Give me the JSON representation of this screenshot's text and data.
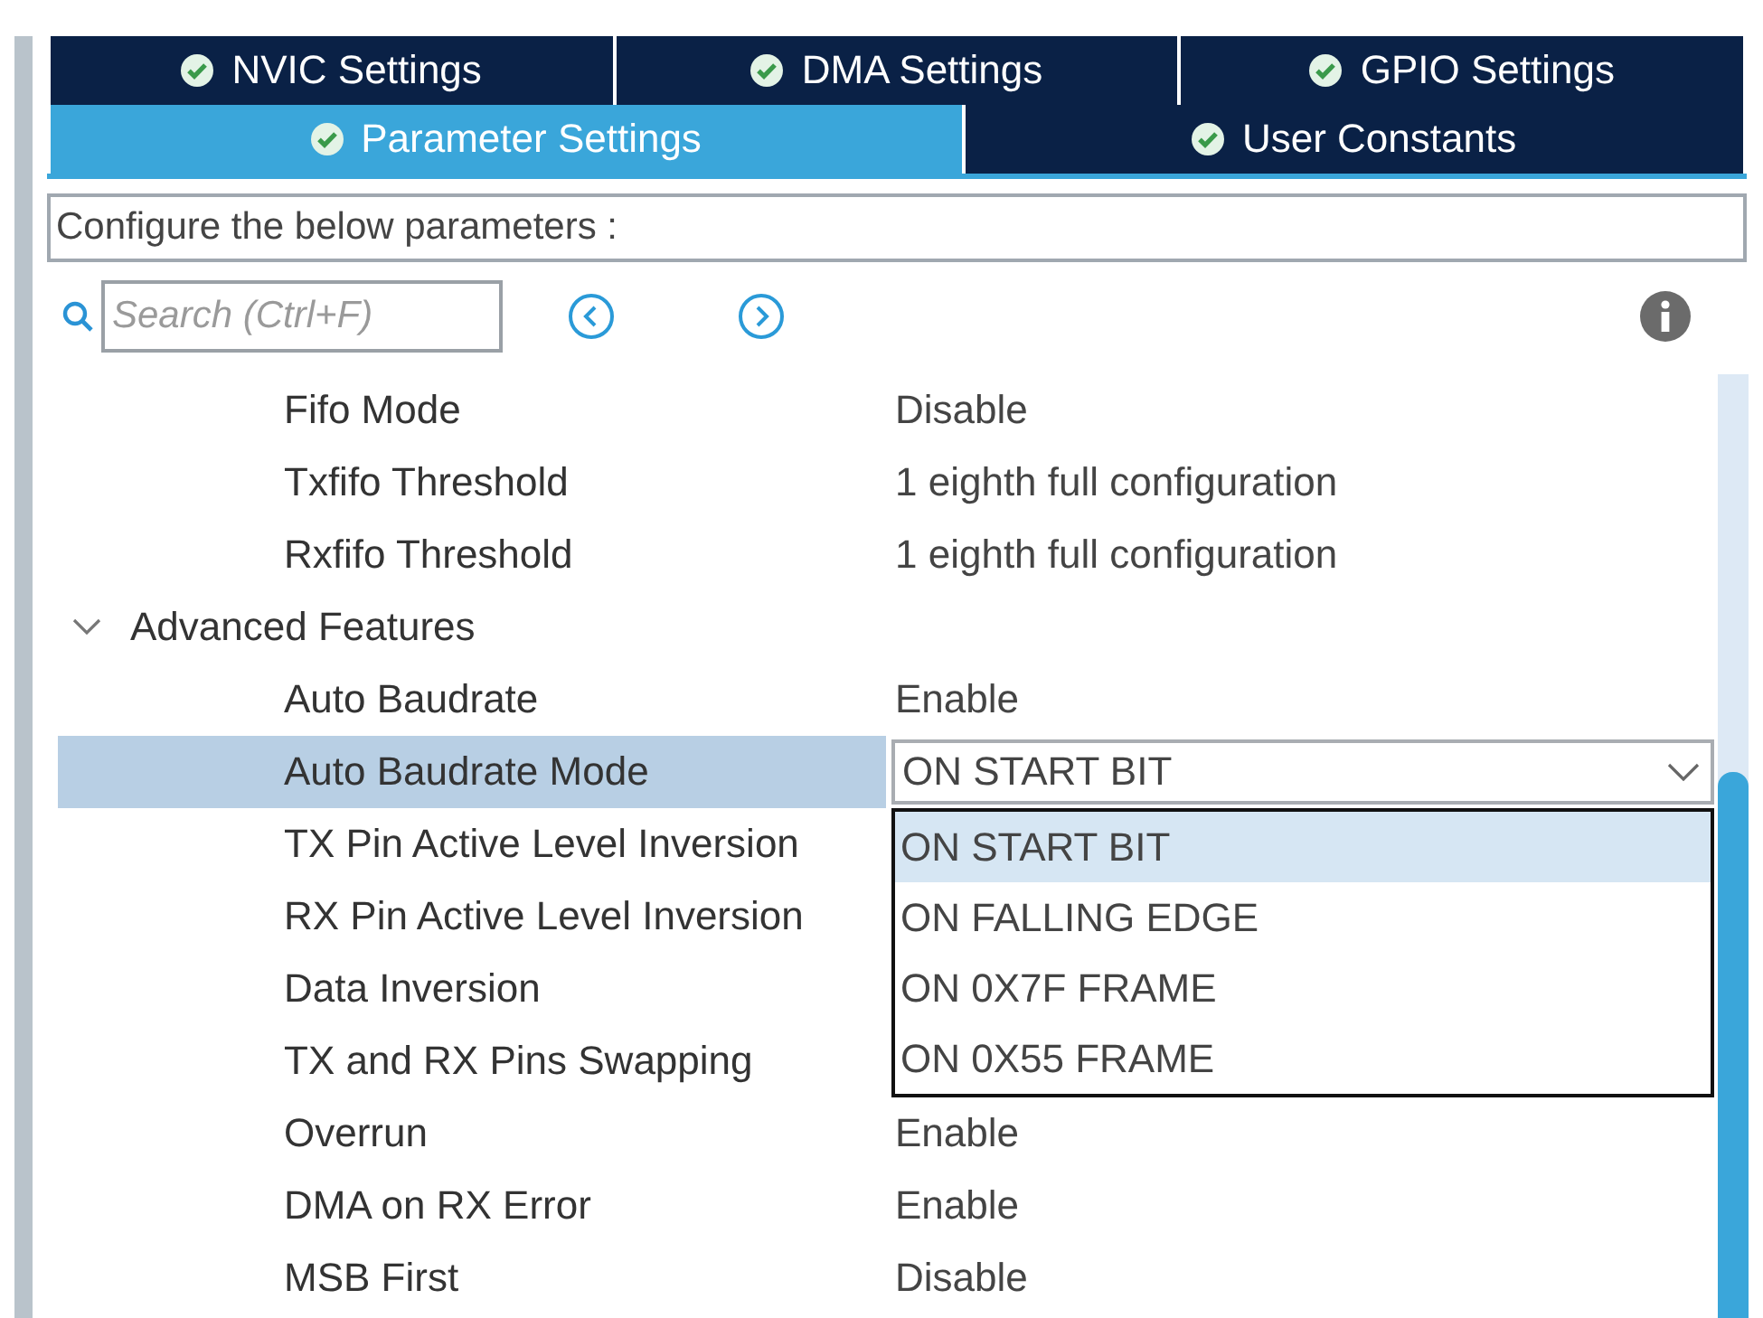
{
  "tab_rows": [
    [
      {
        "label": "NVIC Settings",
        "selected": false
      },
      {
        "label": "DMA Settings",
        "selected": false
      },
      {
        "label": "GPIO Settings",
        "selected": false
      }
    ],
    [
      {
        "label": "Parameter Settings",
        "selected": true
      },
      {
        "label": "User Constants",
        "selected": false
      }
    ]
  ],
  "description": "Configure the below parameters :",
  "search": {
    "placeholder": "Search (Ctrl+F)"
  },
  "rows": [
    {
      "kind": "param",
      "label": "Fifo Mode",
      "value": "Disable",
      "selected": false
    },
    {
      "kind": "param",
      "label": "Txfifo Threshold",
      "value": "1 eighth full configuration",
      "selected": false
    },
    {
      "kind": "param",
      "label": "Rxfifo Threshold",
      "value": "1 eighth full configuration",
      "selected": false
    },
    {
      "kind": "group",
      "label": "Advanced Features",
      "expanded": true
    },
    {
      "kind": "param",
      "label": "Auto Baudrate",
      "value": "Enable",
      "selected": false
    },
    {
      "kind": "select",
      "label": "Auto Baudrate Mode",
      "value": "ON START BIT",
      "selected": true,
      "options": [
        {
          "label": "ON START BIT",
          "selected": true
        },
        {
          "label": "ON FALLING EDGE",
          "selected": false
        },
        {
          "label": "ON 0X7F FRAME",
          "selected": false
        },
        {
          "label": "ON 0X55 FRAME",
          "selected": false
        }
      ]
    },
    {
      "kind": "param",
      "label": "TX Pin Active Level Inversion",
      "selected": false
    },
    {
      "kind": "param",
      "label": "RX Pin Active Level Inversion",
      "selected": false
    },
    {
      "kind": "param",
      "label": "Data Inversion",
      "selected": false
    },
    {
      "kind": "param",
      "label": "TX and RX Pins Swapping",
      "selected": false
    },
    {
      "kind": "param",
      "label": "Overrun",
      "value": "Enable",
      "selected": false
    },
    {
      "kind": "param",
      "label": "DMA on RX Error",
      "value": "Enable",
      "selected": false
    },
    {
      "kind": "param",
      "label": "MSB First",
      "value": "Disable",
      "selected": false
    }
  ]
}
